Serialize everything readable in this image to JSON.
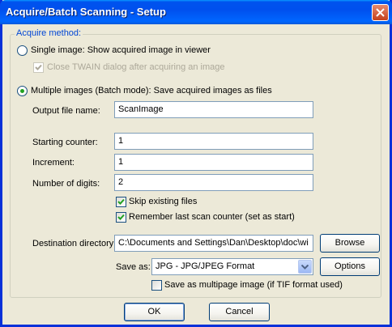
{
  "window": {
    "title": "Acquire/Batch Scanning - Setup"
  },
  "group": {
    "legend": "Acquire method:"
  },
  "single": {
    "label": "Single image: Show acquired image in viewer",
    "close_twain_label": "Close TWAIN dialog after acquiring an image",
    "selected": false,
    "close_twain_checked": true
  },
  "multiple": {
    "label": "Multiple images (Batch mode): Save acquired images as files",
    "selected": true
  },
  "fields": {
    "output_file_name": {
      "label": "Output file name:",
      "value": "ScanImage"
    },
    "starting_counter": {
      "label": "Starting counter:",
      "value": "1"
    },
    "increment": {
      "label": "Increment:",
      "value": "1"
    },
    "number_of_digits": {
      "label": "Number of digits:",
      "value": "2"
    }
  },
  "options": {
    "skip_existing": {
      "label": "Skip existing files",
      "checked": true
    },
    "remember_counter": {
      "label": "Remember last scan counter (set as start)",
      "checked": true
    }
  },
  "destination": {
    "label": "Destination directory:",
    "value": "C:\\Documents and Settings\\Dan\\Desktop\\doc\\wi",
    "browse_label": "Browse"
  },
  "save_as": {
    "label": "Save as:",
    "value": "JPG - JPG/JPEG Format",
    "options_label": "Options"
  },
  "multipage": {
    "label": "Save as multipage image (if TIF format used)",
    "checked": false
  },
  "footer": {
    "ok_label": "OK",
    "cancel_label": "Cancel"
  },
  "colors": {
    "titlebar": "#0054e3",
    "legend": "#0046d5",
    "face": "#ece9d8"
  }
}
